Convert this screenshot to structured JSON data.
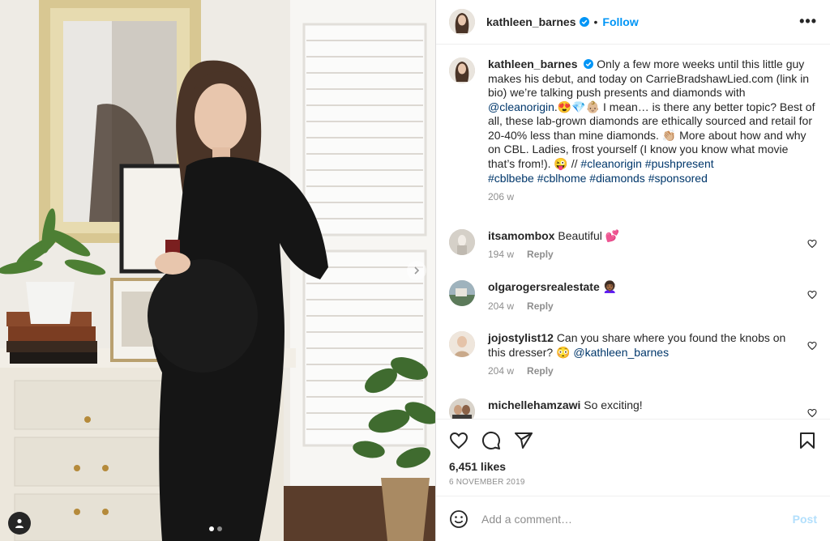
{
  "post": {
    "username": "kathleen_barnes",
    "follow_label": "Follow",
    "separator": "•",
    "more_label": "•••"
  },
  "caption": {
    "username": "kathleen_barnes",
    "text_1": "Only a few more weeks until this little guy makes his debut, and today on CarrieBradshawLied.com (link in bio) we’re talking push presents and diamonds with ",
    "mention": "@cleanorigin",
    "text_2": ".😍💎👶🏼 I mean… is there any better topic?  Best of all, these lab-grown diamonds are ethically sourced and retail for 20-40% less than mine diamonds. 👏🏼 More about how and why on CBL. Ladies, frost yourself (I know you know what movie that’s from!). 😜 // ",
    "hashtags_1": "#cleanorigin #pushpresent",
    "hashtags_2": "#cblbebe #cblhome #diamonds #sponsored",
    "time": "206 w"
  },
  "comments": [
    {
      "username": "itsamombox",
      "text": "Beautiful 💕",
      "time": "194 w",
      "reply": "Reply"
    },
    {
      "username": "olgarogersrealestate",
      "text": "👩🏾‍🦱",
      "time": "204 w",
      "reply": "Reply"
    },
    {
      "username": "jojostylist12",
      "text": "Can you share where you found the knobs on this dresser? 😳 ",
      "mention": "@kathleen_barnes",
      "time": "204 w",
      "reply": "Reply"
    },
    {
      "username": "michellehamzawi",
      "text": "So exciting!"
    }
  ],
  "footer": {
    "likes": "6,451 likes",
    "date": "6 November 2019",
    "add_comment_placeholder": "Add a comment…",
    "post_label": "Post"
  },
  "carousel": {
    "current": 1,
    "total": 2
  },
  "colors": {
    "accent": "#0095f6",
    "link": "#00376b",
    "muted": "#8e8e8e",
    "post_disabled": "#b2dffc"
  },
  "icons": [
    "verified-badge-icon",
    "more-options-icon",
    "heart-icon",
    "comment-icon",
    "share-icon",
    "bookmark-icon",
    "emoji-icon",
    "next-arrow-icon",
    "user-tag-icon"
  ]
}
